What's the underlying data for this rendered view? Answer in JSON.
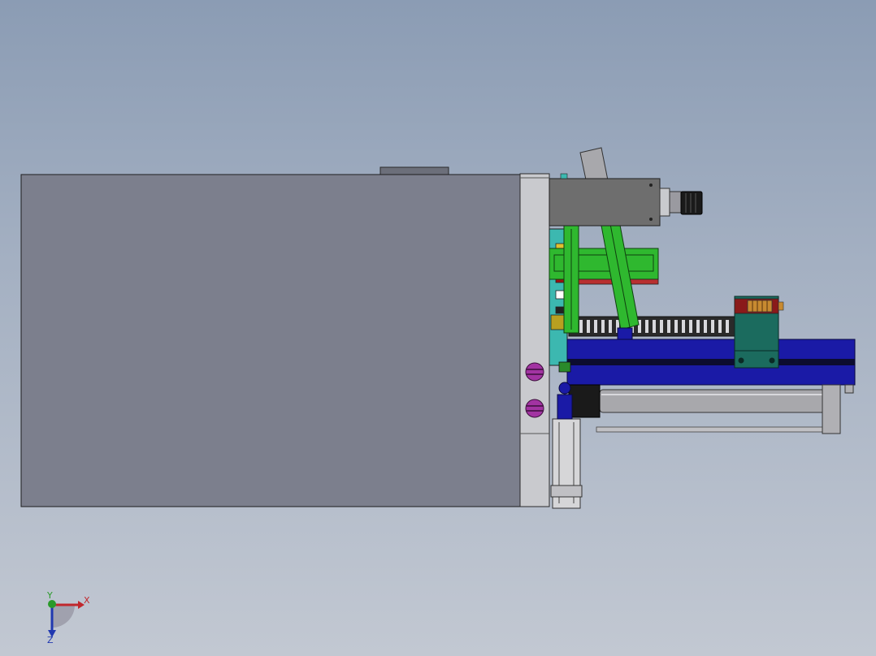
{
  "viewport": {
    "background_top": "#8b9cb4",
    "background_bottom": "#c2c8d2"
  },
  "model": {
    "housing_color": "#7c7f8d",
    "plate_color": "#c9cace",
    "bracket_color": "#6e6e6e",
    "rail_color": "#1a1aa6",
    "green_arm_color": "#2fb82f",
    "teal_block_color": "#1b6b5e",
    "screw_color": "#a233a2",
    "cylinder_color": "#a8a8ac"
  },
  "triad": {
    "x_label": "X",
    "y_label": "Y",
    "z_label": "Z",
    "x_color": "#c0282d",
    "y_color": "#2a9a2a",
    "z_color": "#2038b0"
  }
}
